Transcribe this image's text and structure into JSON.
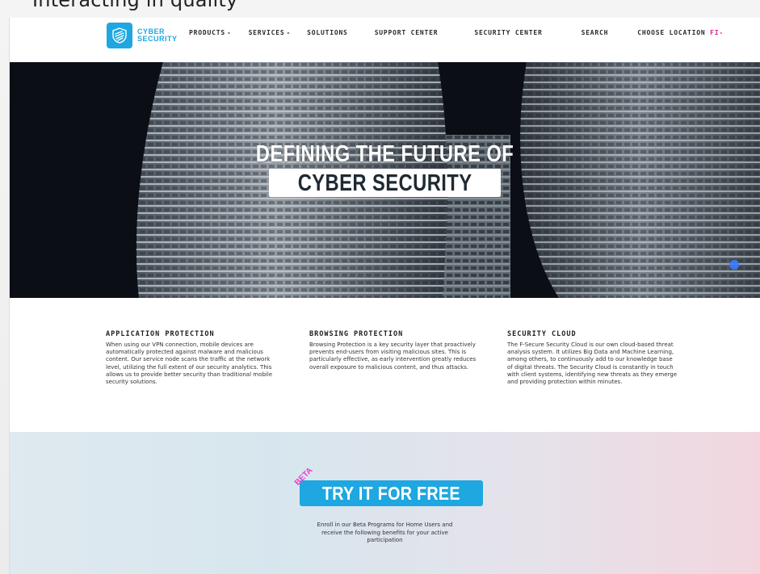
{
  "caption": "Interacting in quality",
  "nav": {
    "logo_line1": "CYBER",
    "logo_line2": "SECURITY",
    "items": [
      {
        "label": "PRODUCTS",
        "caret": "-"
      },
      {
        "label": "SERVICES",
        "caret": "-"
      },
      {
        "label": "SOLUTIONS",
        "caret": ""
      },
      {
        "label": "SUPPORT CENTER",
        "caret": ""
      },
      {
        "label": "SECURITY CENTER",
        "caret": ""
      },
      {
        "label": "SEARCH",
        "caret": ""
      }
    ],
    "location_label": "CHOOSE LOCATION",
    "location_code": "FI-"
  },
  "hero": {
    "line1": "DEFINING THE FUTURE OF",
    "line2": "CYBER SECURITY"
  },
  "features": [
    {
      "title": "APPLICATION PROTECTION",
      "body": "When using our VPN connection, mobile devices are automatically protected against malware and malicious content. Our service node scans the traffic at the network level, utilizing the full extent of our security analytics. This allows us to provide better security than traditional mobile security solutions."
    },
    {
      "title": "BROWSING PROTECTION",
      "body": "Browsing Protection is a key security layer that proactively prevents end-users from visiting malicious sites. This is particularly effective, as early intervention greatly reduces overall exposure to malicious content, and thus attacks."
    },
    {
      "title": "SECURITY CLOUD",
      "body": "The F-Secure Security Cloud is our own cloud-based threat analysis system. It utilizes Big Data and Machine Learning, among others, to continuously add to our knowledge base of digital threats. The Security Cloud is constantly in touch with client systems, identifying new threats as they emerge and providing protection within minutes."
    }
  ],
  "cta": {
    "badge": "BETA",
    "button_label": "TRY IT FOR FREE",
    "text": "Enroll in our Beta Programs for Home Users and receive the following benefits for your active participation"
  },
  "colors": {
    "accent": "#1ea7e0",
    "beta": "#e83ec9",
    "location_code": "#e0208a"
  }
}
